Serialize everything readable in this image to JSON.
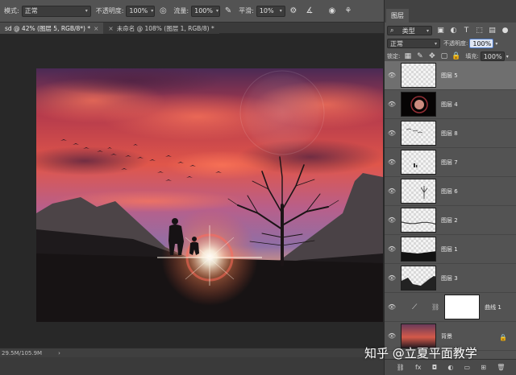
{
  "options_bar": {
    "mode_label": "模式:",
    "mode_value": "正常",
    "opacity_label": "不透明度:",
    "opacity_value": "100%",
    "flow_label": "流量:",
    "flow_value": "100%",
    "smooth_label": "平滑:",
    "smooth_value": "10%"
  },
  "tabs": [
    {
      "label": "sd @ 42% (图层 5, RGB/8*) *",
      "close": "×"
    },
    {
      "label": "未命名 @ 108% (图层 1, RGB/8) *",
      "close": "×"
    }
  ],
  "status": {
    "doc_size": "29.5M/105.9M",
    "arrow": "›"
  },
  "layers_panel": {
    "tab_label": "图层",
    "kind_label": "类型",
    "blend_mode": "正常",
    "opacity_label": "不透明度:",
    "opacity_value": "100%",
    "lock_label": "锁定:",
    "fill_label": "填充:",
    "fill_value": "100%",
    "layers": [
      {
        "name": "图层 5",
        "selected": true
      },
      {
        "name": "图层 4"
      },
      {
        "name": "图层 8"
      },
      {
        "name": "图层 7"
      },
      {
        "name": "图层 6"
      },
      {
        "name": "图层 2"
      },
      {
        "name": "图层 1"
      },
      {
        "name": "图层 3"
      },
      {
        "name": "曲线 1"
      },
      {
        "name": "背景"
      }
    ],
    "footer_icons": [
      "link-icon",
      "fx-icon",
      "mask-icon",
      "adjustment-icon",
      "group-icon",
      "new-layer-icon",
      "trash-icon"
    ],
    "footer_glyphs": [
      "⛓",
      "fx",
      "◘",
      "◐",
      "▭",
      "⊞",
      "🗑"
    ]
  },
  "watermark": "知乎 @立夏平面教学",
  "colors": {
    "panel_bg": "#535353",
    "canvas_bg": "#282828",
    "selected_layer": "#6f6f6f"
  }
}
